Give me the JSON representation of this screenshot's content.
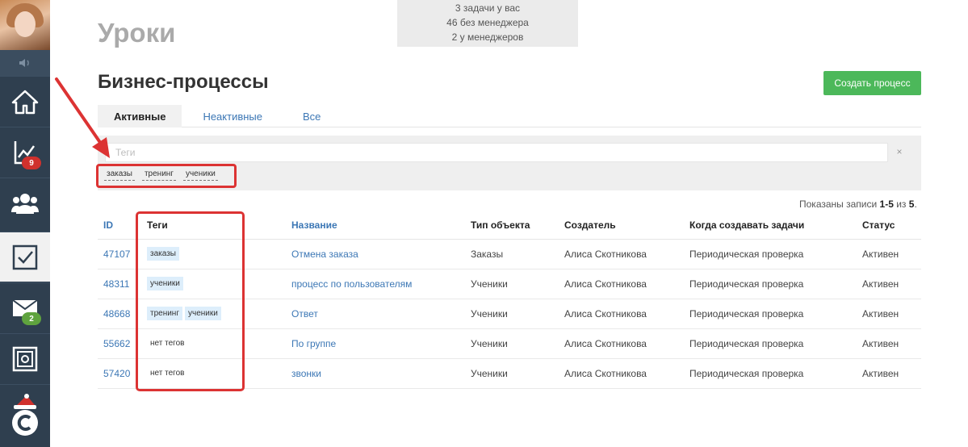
{
  "sidebar": {
    "badges": {
      "reports": "9",
      "mail": "2"
    },
    "items": [
      {
        "name": "home-icon"
      },
      {
        "name": "reports-icon"
      },
      {
        "name": "users-icon"
      },
      {
        "name": "tasks-icon"
      },
      {
        "name": "mail-icon"
      },
      {
        "name": "safe-icon"
      },
      {
        "name": "logo-icon"
      }
    ]
  },
  "topbox": {
    "line1": "3 задачи у вас",
    "line2": "46 без менеджера",
    "line3": "2 у менеджеров"
  },
  "page": {
    "heading": "Уроки",
    "title": "Бизнес-процессы",
    "create_button": "Создать процесс"
  },
  "tabs": [
    "Активные",
    "Неактивные",
    "Все"
  ],
  "filter": {
    "placeholder": "Теги",
    "clear": "×",
    "tags": [
      "заказы",
      "тренинг",
      "ученики"
    ]
  },
  "records": {
    "prefix": "Показаны записи ",
    "range": "1-5",
    "middle": " из ",
    "total": "5",
    "suffix": "."
  },
  "table": {
    "headers": [
      "ID",
      "Теги",
      "Название",
      "Тип объекта",
      "Создатель",
      "Когда создавать задачи",
      "Статус"
    ],
    "rows": [
      {
        "id": "47107",
        "tags": [
          "заказы"
        ],
        "name": "Отмена заказа",
        "type": "Заказы",
        "creator": "Алиса Скотникова",
        "when": "Периодическая проверка",
        "status": "Активен"
      },
      {
        "id": "48311",
        "tags": [
          "ученики"
        ],
        "name": "процесс по пользователям",
        "type": "Ученики",
        "creator": "Алиса Скотникова",
        "when": "Периодическая проверка",
        "status": "Активен"
      },
      {
        "id": "48668",
        "tags": [
          "тренинг",
          "ученики"
        ],
        "name": "Ответ",
        "type": "Ученики",
        "creator": "Алиса Скотникова",
        "when": "Периодическая проверка",
        "status": "Активен"
      },
      {
        "id": "55662",
        "no_tags": "нет тегов",
        "name": "По группе",
        "type": "Ученики",
        "creator": "Алиса Скотникова",
        "when": "Периодическая проверка",
        "status": "Активен"
      },
      {
        "id": "57420",
        "no_tags": "нет тегов",
        "name": "звонки",
        "type": "Ученики",
        "creator": "Алиса Скотникова",
        "when": "Периодическая проверка",
        "status": "Активен"
      }
    ]
  },
  "colors": {
    "sidebar": "#2f3f4f",
    "accent_green": "#4cb85a",
    "link_blue": "#3c77b5",
    "highlight_red": "#dc3333"
  }
}
